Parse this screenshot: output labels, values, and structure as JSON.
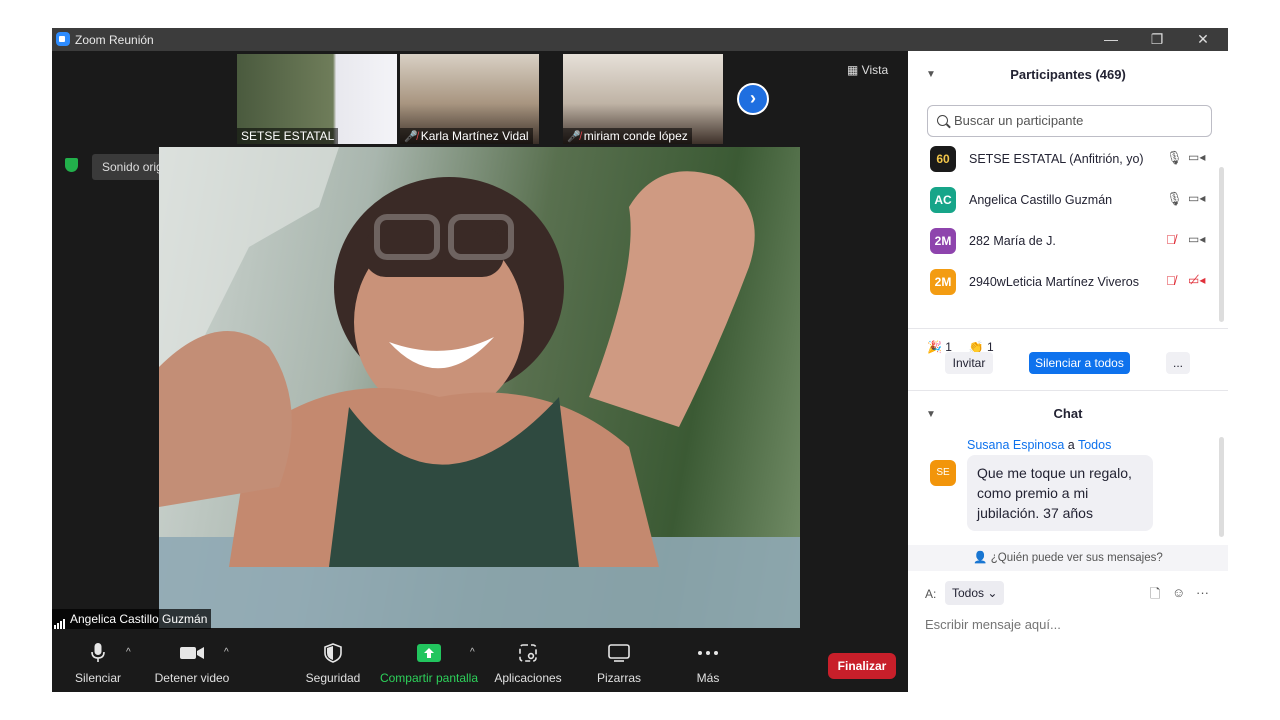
{
  "window": {
    "title": "Zoom Reunión",
    "minimize": "—",
    "restore": "❐",
    "close": "✕"
  },
  "thumbnails": [
    {
      "name": "SETSE ESTATAL",
      "muted": false
    },
    {
      "name": "Karla Martínez Vidal",
      "muted": true
    },
    {
      "name": "miriam conde lópez",
      "muted": true
    }
  ],
  "view_button": "Vista",
  "original_sound": "Sonido original: desactivado",
  "active_speaker": "Angelica Castillo Guzmán",
  "toolbar": {
    "mute": "Silenciar",
    "stop_video": "Detener video",
    "security": "Seguridad",
    "share_screen": "Compartir pantalla",
    "apps": "Aplicaciones",
    "whiteboards": "Pizarras",
    "more": "Más",
    "end": "Finalizar"
  },
  "participants": {
    "title": "Participantes (469)",
    "search_placeholder": "Buscar un participante",
    "list": [
      {
        "initials": "60",
        "name": "SETSE ESTATAL (Anfitrión, yo)",
        "color": "#1a1a1a",
        "mic_muted": false,
        "cam_off": false
      },
      {
        "initials": "AC",
        "name": "Angelica Castillo Guzmán",
        "color": "#17a589",
        "mic_muted": false,
        "cam_off": false
      },
      {
        "initials": "2M",
        "name": "282 María de J.",
        "color": "#8e44ad",
        "mic_muted": true,
        "cam_off": false
      },
      {
        "initials": "2M",
        "name": "2940wLeticia Martínez Viveros",
        "color": "#f39c12",
        "mic_muted": true,
        "cam_off": true
      }
    ],
    "reactions": [
      {
        "icon": "🎉",
        "count": "1"
      },
      {
        "icon": "👏",
        "count": "1"
      }
    ],
    "invite": "Invitar",
    "mute_all": "Silenciar a todos",
    "more": "..."
  },
  "chat": {
    "title": "Chat",
    "sender": "Susana Espinosa",
    "to_word": "a",
    "recipient": "Todos",
    "avatar": "SE",
    "message": "Que me toque un regalo, como premio a mi jubilación. 37 años",
    "who_can_see": "¿Quién puede ver sus mensajes?",
    "to_label": "A:",
    "to_value": "Todos",
    "input_placeholder": "Escribir mensaje aquí..."
  }
}
